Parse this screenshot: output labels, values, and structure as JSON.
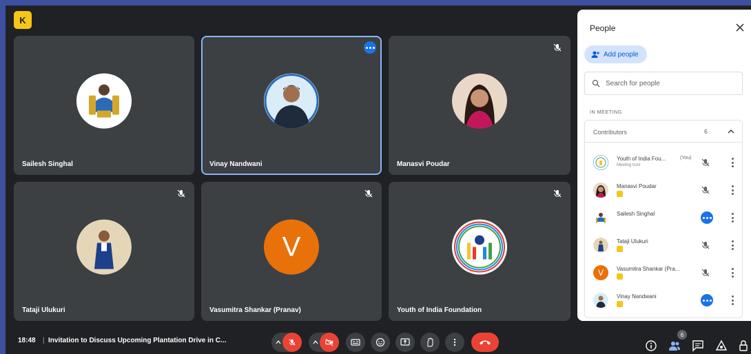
{
  "app": {
    "logo_icon": "meet-logo-icon"
  },
  "tiles": [
    {
      "name": "Sailesh Singhal",
      "avatar": "photo",
      "mic_muted": false,
      "active": false
    },
    {
      "name": "Vinay Nandwani",
      "avatar": "photo",
      "mic_muted": false,
      "active": true
    },
    {
      "name": "Manasvi Poudar",
      "avatar": "photo",
      "mic_muted": true,
      "active": false
    },
    {
      "name": "Tataji Ulukuri",
      "avatar": "photo",
      "mic_muted": true,
      "active": false
    },
    {
      "name": "Vasumitra Shankar (Pranav)",
      "avatar": "letter",
      "letter": "V",
      "mic_muted": true,
      "active": false
    },
    {
      "name": "Youth of India Foundation",
      "avatar": "logo",
      "mic_muted": true,
      "active": false
    }
  ],
  "panel": {
    "title": "People",
    "add_people": "Add people",
    "search_placeholder": "Search for people",
    "section_label": "IN MEETING",
    "group_title": "Contributors",
    "group_count": "6",
    "people": [
      {
        "name": "Youth of India Fou...",
        "host": "(You)",
        "sub": "Meeting host",
        "mic": "muted"
      },
      {
        "name": "Manasvi Poudar",
        "mic": "muted"
      },
      {
        "name": "Sailesh Singhal",
        "mic": "speaking"
      },
      {
        "name": "Tataji Ulukuri",
        "mic": "muted"
      },
      {
        "name": "Vasumitra Shankar (Pra...",
        "mic": "muted"
      },
      {
        "name": "Vinay Nandwani",
        "mic": "speaking"
      }
    ]
  },
  "bar": {
    "time": "18:48",
    "divider": "|",
    "meeting_title": "Invitation to Discuss Upcoming Plantation Drive in C...",
    "people_count": "6"
  },
  "colors": {
    "page_bg": "#202124",
    "tile_bg": "#3c4043",
    "accent_blue": "#1a73e8",
    "danger_red": "#ea4335",
    "frame": "#3f4fa0"
  }
}
